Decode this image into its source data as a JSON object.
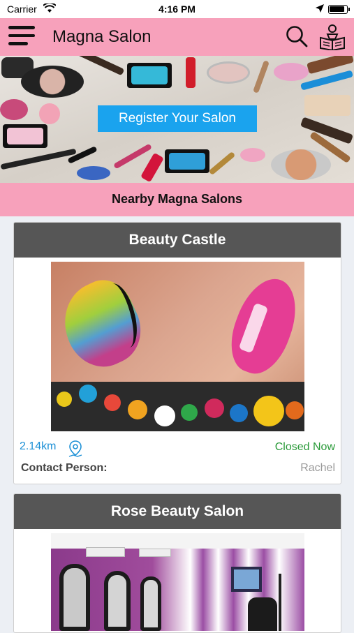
{
  "status_bar": {
    "carrier": "Carrier",
    "time": "4:16 PM"
  },
  "nav": {
    "title": "Magna Salon",
    "menu_icon": "hamburger-menu-icon",
    "search_icon": "search-icon",
    "book_icon": "reading-book-icon"
  },
  "banner": {
    "register_label": "Register Your Salon"
  },
  "section": {
    "nearby_title": "Nearby Magna Salons"
  },
  "salons": [
    {
      "name": "Beauty Castle",
      "distance": "2.14km",
      "status": "Closed Now",
      "contact_label": "Contact Person:",
      "contact_value": "Rachel"
    },
    {
      "name": "Rose Beauty Salon"
    }
  ],
  "colors": {
    "nav_pink": "#f7a1bb",
    "card_header": "#565656",
    "register_blue": "#1aa3ee",
    "distance_blue": "#1c90d6",
    "status_green": "#2a9a39"
  }
}
